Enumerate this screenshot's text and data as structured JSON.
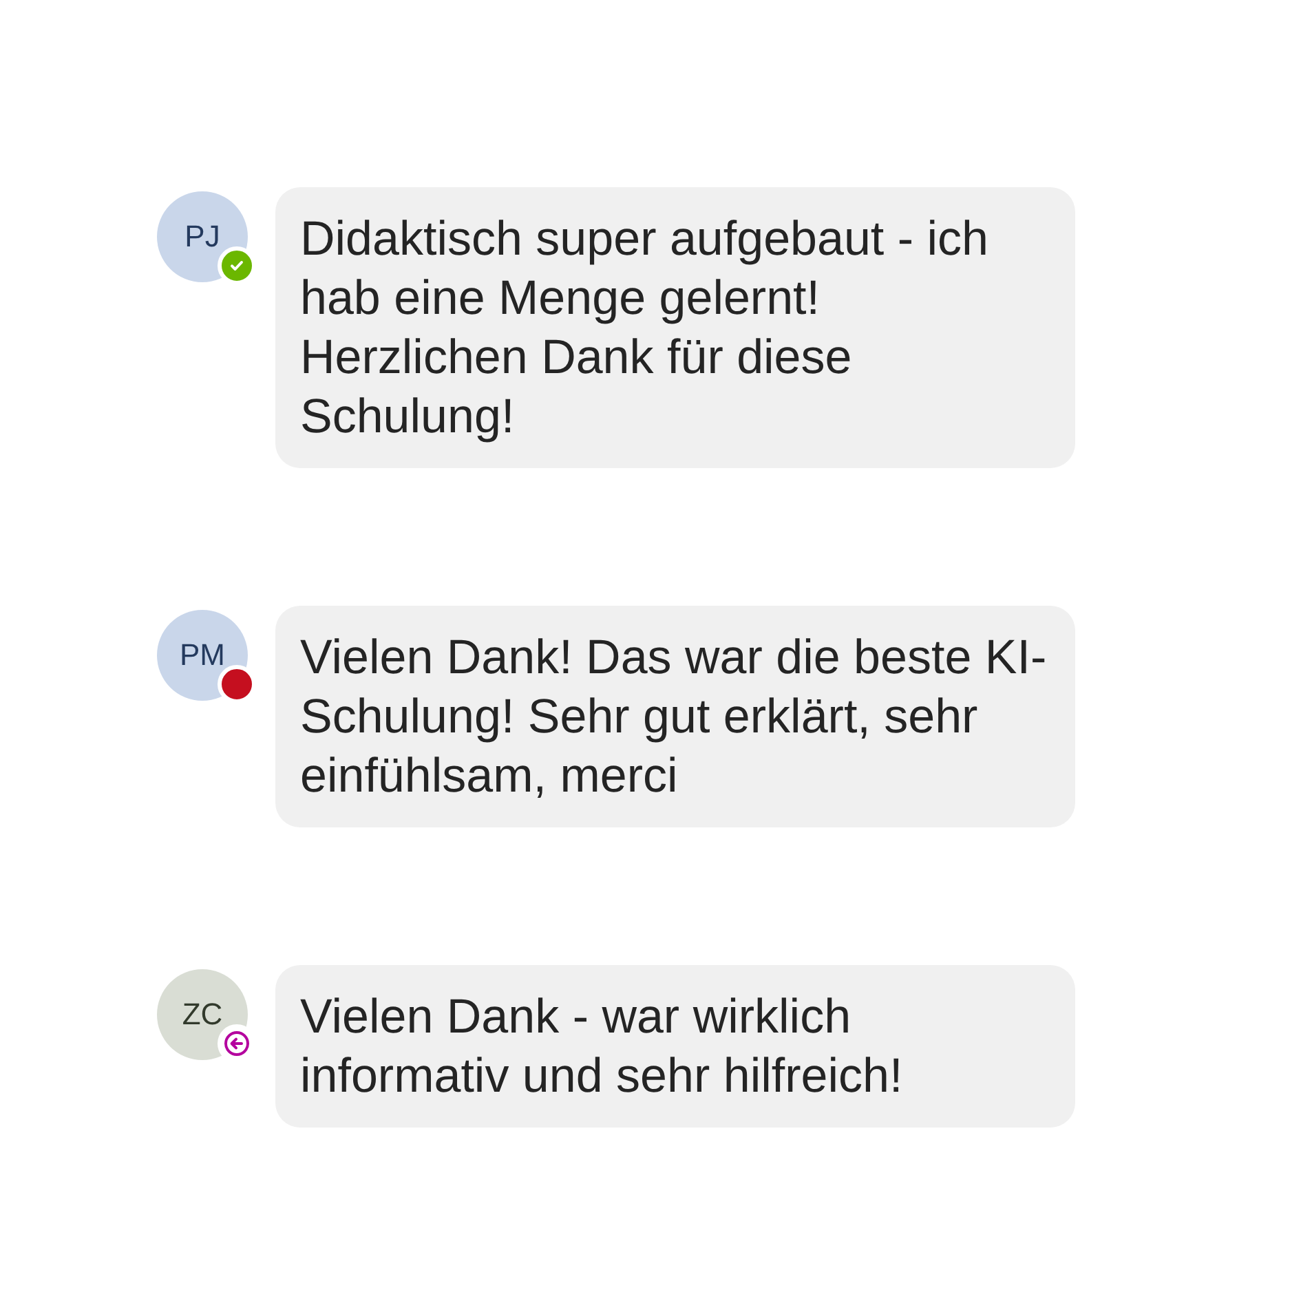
{
  "messages": [
    {
      "initials": "PJ",
      "color": "#c9d6ea",
      "kind": "available",
      "text": "Didaktisch super aufgebaut - ich hab eine Menge gelernt! Herzlichen Dank für diese Schulung!"
    },
    {
      "initials": "PM",
      "color": "#c9d6ea",
      "kind": "busy",
      "text": "Vielen Dank! Das war die beste KI-Schulung! Sehr gut erklärt, sehr einfühlsam, merci"
    },
    {
      "initials": "ZC",
      "color": "#d9ddd4",
      "kind": "away",
      "text": "Vielen Dank - war wirklich informativ und sehr hilfreich!"
    }
  ]
}
